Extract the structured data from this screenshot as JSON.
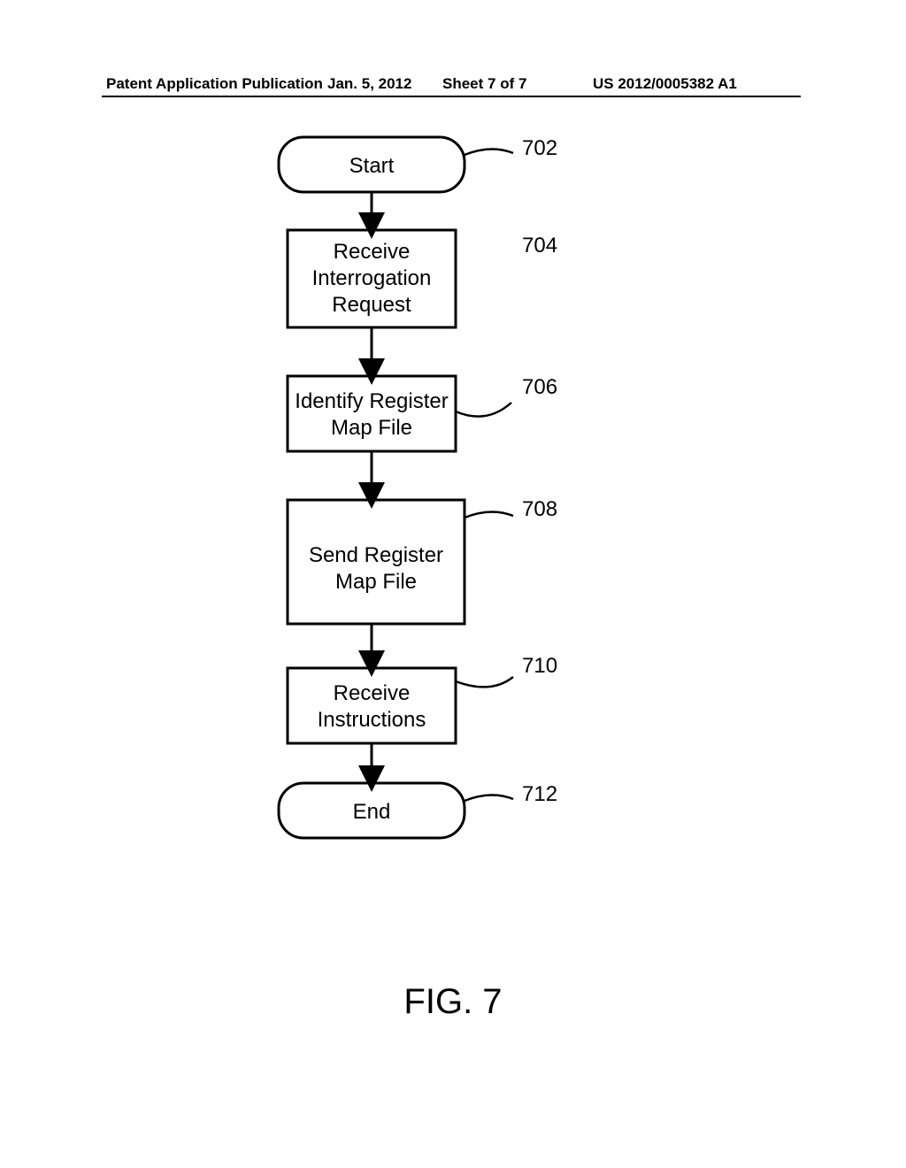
{
  "header": {
    "pub_type": "Patent Application Publication",
    "date": "Jan. 5, 2012",
    "sheet": "Sheet 7 of 7",
    "pub_number": "US 2012/0005382 A1"
  },
  "figure_label": "FIG. 7",
  "flowchart": {
    "nodes": [
      {
        "id": "start",
        "label": "Start",
        "ref": "702",
        "shape": "terminator"
      },
      {
        "id": "receive-request",
        "label": "Receive Interrogation Request",
        "ref": "704",
        "shape": "process"
      },
      {
        "id": "identify-map",
        "label": "Identify Register Map File",
        "ref": "706",
        "shape": "process"
      },
      {
        "id": "send-map",
        "label": "Send Register Map File",
        "ref": "708",
        "shape": "process"
      },
      {
        "id": "receive-instr",
        "label": "Receive Instructions",
        "ref": "710",
        "shape": "process"
      },
      {
        "id": "end",
        "label": "End",
        "ref": "712",
        "shape": "terminator"
      }
    ]
  }
}
